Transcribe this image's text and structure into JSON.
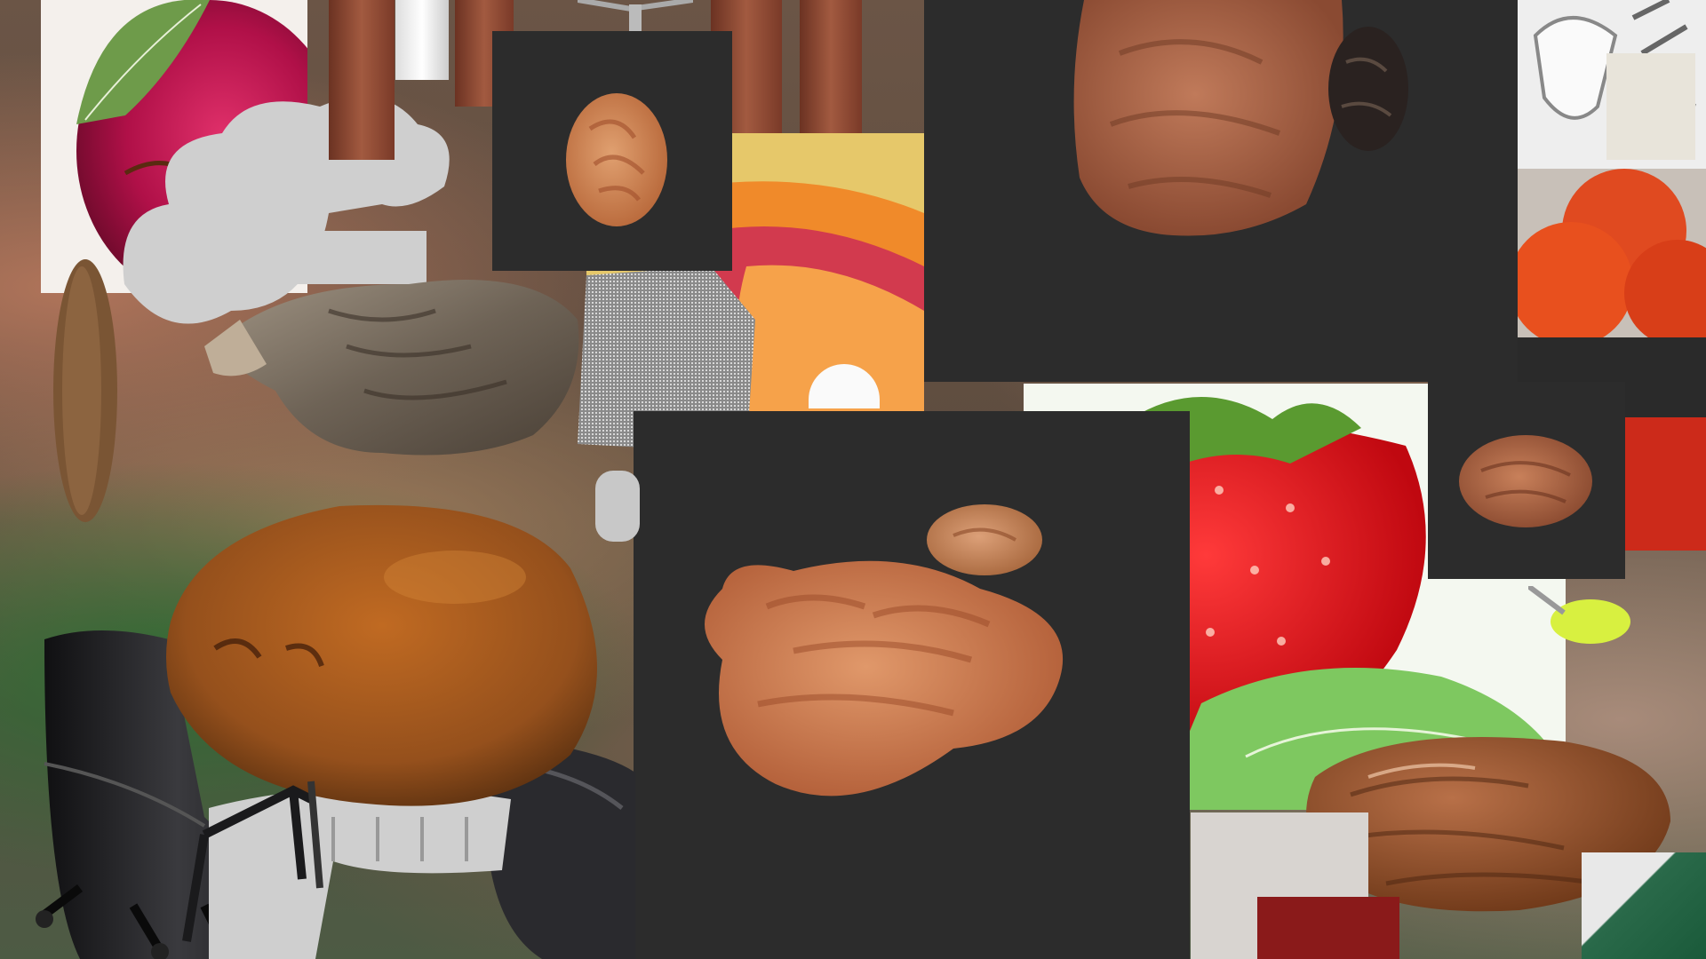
{
  "scene": {
    "description_tag": "photo-collage",
    "colors": {
      "panel": "#2c2c2c",
      "strawberry": "#d8141c",
      "date_fruit": "#b56a3e",
      "mango": "#a0561e",
      "chair": "#1e1e20",
      "wood": "#8a4a34",
      "cloud_silhouette": "#cfcfcf"
    }
  }
}
